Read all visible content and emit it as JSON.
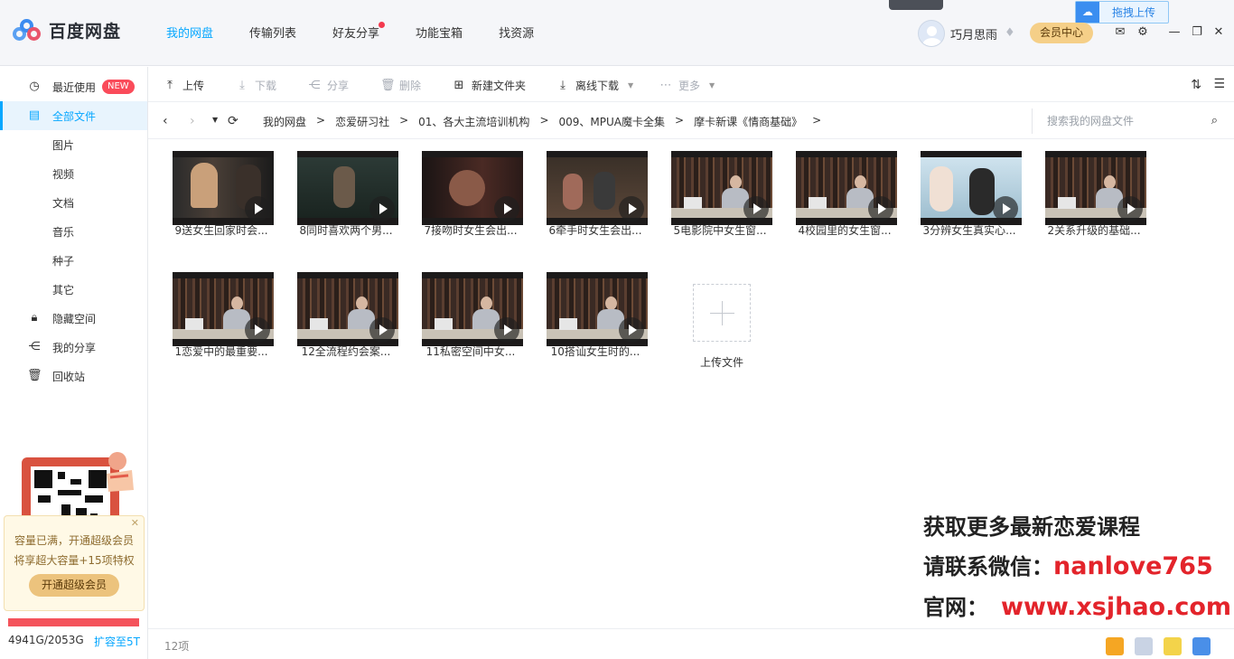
{
  "app": {
    "title": "百度网盘",
    "nav": [
      {
        "label": "我的网盘",
        "active": true
      },
      {
        "label": "传输列表",
        "active": false
      },
      {
        "label": "好友分享",
        "active": false,
        "dot": true
      },
      {
        "label": "功能宝箱",
        "active": false
      },
      {
        "label": "找资源",
        "active": false
      }
    ],
    "username": "巧月思雨",
    "vip_center": "会员中心",
    "drag_upload": "拖拽上传",
    "accent": "#06a7ff"
  },
  "sidebar": {
    "items": [
      {
        "label": "最近使用",
        "icon": "clock-icon",
        "badge": "NEW"
      },
      {
        "label": "全部文件",
        "icon": "document-icon",
        "active": true
      },
      {
        "label": "图片"
      },
      {
        "label": "视频"
      },
      {
        "label": "文档"
      },
      {
        "label": "音乐"
      },
      {
        "label": "种子"
      },
      {
        "label": "其它"
      },
      {
        "label": "隐藏空间",
        "icon": "lock-icon"
      },
      {
        "label": "我的分享",
        "icon": "share-icon"
      },
      {
        "label": "回收站",
        "icon": "trash-icon"
      }
    ],
    "promo": {
      "line1": "容量已满，开通超级会员",
      "line2": "将享超大容量+15项特权",
      "button": "开通超级会员"
    },
    "quota": {
      "text": "4941G/2053G",
      "fill_fraction": 1.0,
      "expand": "扩容至5T"
    }
  },
  "toolbar": {
    "upload": "上传",
    "download": "下载",
    "share": "分享",
    "delete": "删除",
    "new_folder": "新建文件夹",
    "offline_download": "离线下载",
    "more": "更多"
  },
  "path": {
    "crumbs": [
      "我的网盘",
      "恋爱研习社",
      "01、各大主流培训机构",
      "009、MPUA魔卡全集",
      "摩卡新课《情商基础》"
    ],
    "search_placeholder": "搜索我的网盘文件"
  },
  "files": [
    {
      "name": "9送女生回家时会...",
      "scene": "movie-a"
    },
    {
      "name": "8同时喜欢两个男...",
      "scene": "movie-b"
    },
    {
      "name": "7接吻时女生会出...",
      "scene": "movie-c"
    },
    {
      "name": "6牵手时女生会出...",
      "scene": "movie-d"
    },
    {
      "name": "5电影院中女生窗...",
      "scene": "studio"
    },
    {
      "name": "4校园里的女生窗...",
      "scene": "studio"
    },
    {
      "name": "3分辨女生真实心...",
      "scene": "movie-e"
    },
    {
      "name": "2关系升级的基础...",
      "scene": "studio"
    },
    {
      "name": "1恋爱中的最重要...",
      "scene": "studio"
    },
    {
      "name": "12全流程约会案...",
      "scene": "studio"
    },
    {
      "name": "11私密空间中女...",
      "scene": "studio"
    },
    {
      "name": "10搭讪女生时的...",
      "scene": "studio"
    }
  ],
  "upload_tile": "上传文件",
  "watermark": {
    "line1": "获取更多最新恋爱课程",
    "line2_prefix": "请联系微信：",
    "line2_value": "nanlove765",
    "line3_prefix": "官网：",
    "line3_value": "www.xsjhao.com"
  },
  "status": {
    "count": "12项"
  }
}
